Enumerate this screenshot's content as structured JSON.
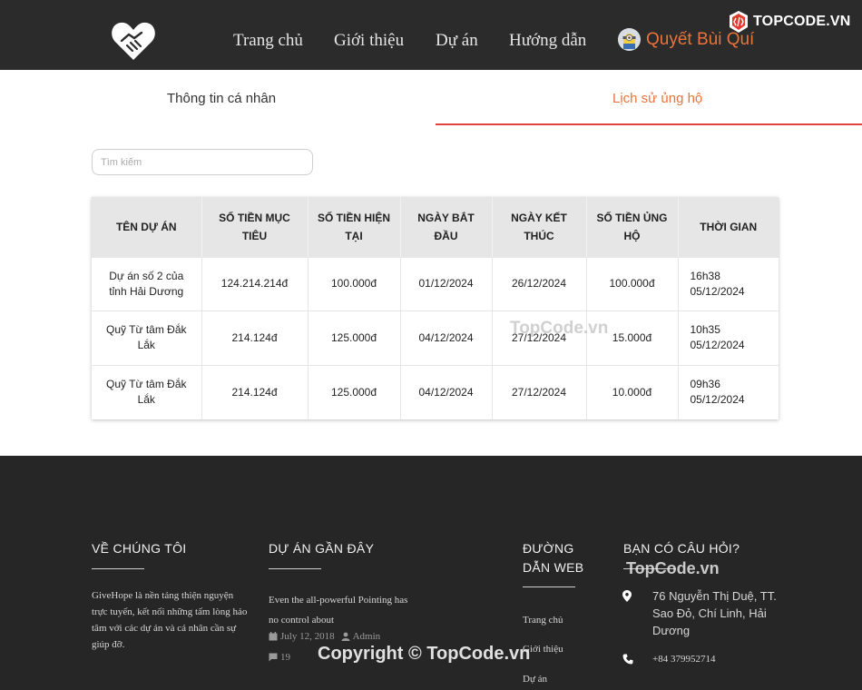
{
  "nav": {
    "links": [
      "Trang chủ",
      "Giới thiệu",
      "Dự án",
      "Hướng dẫn"
    ],
    "user_name": "Quyết Bùi Quí",
    "brand": "TOPCODE.VN"
  },
  "tabs": {
    "personal": "Thông tin cá nhân",
    "history": "Lịch sử ủng hộ"
  },
  "search": {
    "placeholder": "Tìm kiếm"
  },
  "table": {
    "headers": [
      "TÊN DỰ ÁN",
      "SỐ TIỀN MỤC TIÊU",
      "SỐ TIỀN HIỆN TẠI",
      "NGÀY BẮT ĐẦU",
      "NGÀY KẾT THÚC",
      "SỐ TIỀN ỦNG HỘ",
      "THỜI GIAN"
    ],
    "rows": [
      [
        "Dự án số 2 của tỉnh Hải Dương",
        "124.214.214đ",
        "100.000đ",
        "01/12/2024",
        "26/12/2024",
        "100.000đ",
        "16h38 05/12/2024"
      ],
      [
        "Quỹ Từ tâm Đắk Lắk",
        "214.124đ",
        "125.000đ",
        "04/12/2024",
        "27/12/2024",
        "15.000đ",
        "10h35 05/12/2024"
      ],
      [
        "Quỹ Từ tâm Đắk Lắk",
        "214.124đ",
        "125.000đ",
        "04/12/2024",
        "27/12/2024",
        "10.000đ",
        "09h36 05/12/2024"
      ]
    ]
  },
  "footer": {
    "about": {
      "title": "VỀ CHÚNG TÔI",
      "text": "GiveHope là nền tảng thiện nguyện trực tuyến, kết nối những tấm lòng hảo tâm với các dự án và cá nhân cần sự giúp đỡ."
    },
    "recent": {
      "title": "DỰ ÁN GẦN ĐÂY",
      "post_title": "Even the all-powerful Pointing has no control about",
      "date": "July 12, 2018",
      "author": "Admin",
      "comments": "19"
    },
    "links": {
      "title": "ĐƯỜNG DẪN WEB",
      "items": [
        "Trang chủ",
        "Giới thiệu",
        "Dự án"
      ]
    },
    "contact": {
      "title": "BẠN CÓ CÂU HỎI?",
      "address": "76 Nguyễn Thị Duệ, TT. Sao Đỏ, Chí Linh, Hải Dương",
      "phone": "+84 379952714"
    }
  },
  "watermarks": {
    "center": "TopCode.vn",
    "footer": "TopCode.vn",
    "copyright": "Copyright © TopCode.vn"
  }
}
